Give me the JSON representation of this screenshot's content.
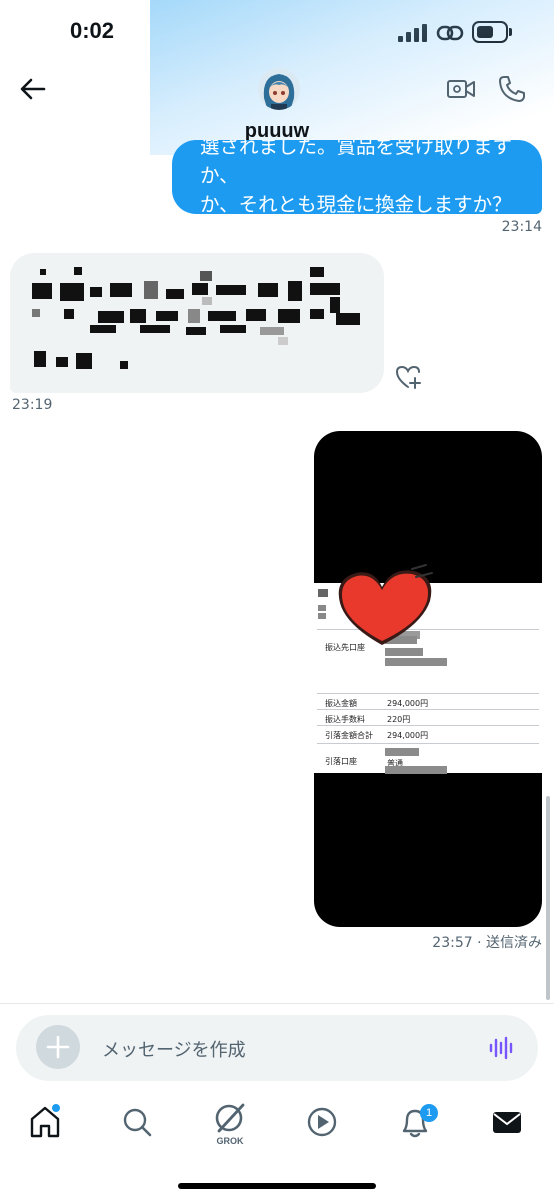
{
  "status_bar": {
    "time": "0:02"
  },
  "header": {
    "name": "puuuw"
  },
  "messages": [
    {
      "direction": "out",
      "lines": [
        "選されました。賞品を受け取りますか、",
        "か、それとも現金に換金しますか？"
      ],
      "time": "23:14"
    },
    {
      "direction": "in",
      "content": "mosaic",
      "time": "23:19"
    },
    {
      "direction": "out",
      "content": "image",
      "time": "23:57 · 送信済み"
    }
  ],
  "transfer_doc": {
    "rows": [
      {
        "label": "振込先口座",
        "value": ""
      },
      {
        "label": "振込金額",
        "value": "294,000円"
      },
      {
        "label": "振込手数料",
        "value": "220円"
      },
      {
        "label": "引落金額合計",
        "value": "294,000円"
      },
      {
        "label": "引落口座",
        "value": "普通"
      }
    ]
  },
  "composer": {
    "placeholder": "メッセージを作成"
  },
  "nav": {
    "grok_label": "GROK",
    "notification_count": "1"
  },
  "colors": {
    "accent": "#1d9bf0",
    "bubble_in": "#eff3f4",
    "heart": "#e8392c"
  }
}
